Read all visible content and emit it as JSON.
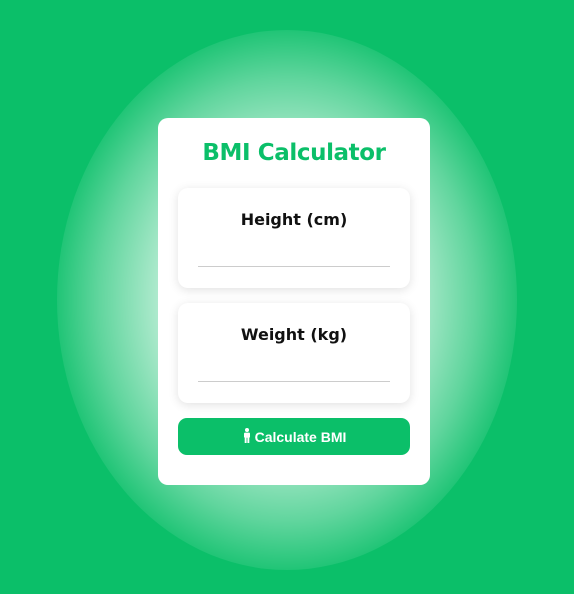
{
  "app": {
    "title": "BMI Calculator"
  },
  "colors": {
    "accent": "#0bbf69",
    "background": "#0bbf69",
    "card": "#ffffff"
  },
  "height_field": {
    "label": "Height (cm)",
    "value": "",
    "placeholder": ""
  },
  "weight_field": {
    "label": "Weight (kg)",
    "value": "",
    "placeholder": ""
  },
  "calculate_button": {
    "icon": "person-icon",
    "label": "Calculate BMI"
  }
}
